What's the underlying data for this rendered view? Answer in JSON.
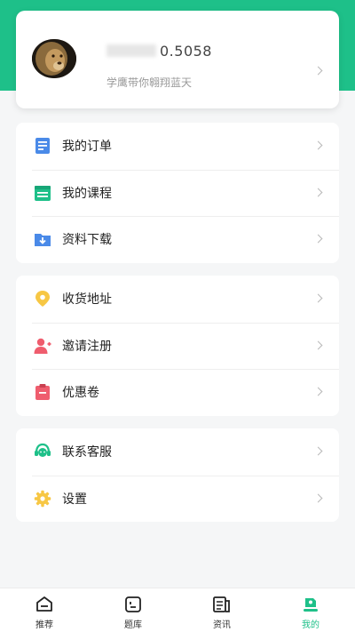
{
  "profile": {
    "username_visible": "0.5058",
    "slogan": "学鹰带你翱翔蓝天"
  },
  "groups": [
    {
      "items": [
        {
          "label": "我的订单",
          "icon": "order-list-icon",
          "color": "#4a8ae8"
        },
        {
          "label": "我的课程",
          "icon": "course-calendar-icon",
          "color": "#1ec089"
        },
        {
          "label": "资料下载",
          "icon": "folder-download-icon",
          "color": "#4a8ae8"
        }
      ]
    },
    {
      "items": [
        {
          "label": "收货地址",
          "icon": "location-pin-icon",
          "color": "#f7c744"
        },
        {
          "label": "邀请注册",
          "icon": "invite-user-icon",
          "color": "#ef5d6e"
        },
        {
          "label": "优惠卷",
          "icon": "coupon-clipboard-icon",
          "color": "#ef5d6e"
        }
      ]
    },
    {
      "items": [
        {
          "label": "联系客服",
          "icon": "customer-service-icon",
          "color": "#1ec089"
        },
        {
          "label": "设置",
          "icon": "settings-gear-icon",
          "color": "#f7c744"
        }
      ]
    }
  ],
  "tabbar": {
    "tabs": [
      {
        "label": "推荐",
        "icon": "home-icon",
        "active": false
      },
      {
        "label": "题库",
        "icon": "question-bank-icon",
        "active": false
      },
      {
        "label": "资讯",
        "icon": "news-icon",
        "active": false
      },
      {
        "label": "我的",
        "icon": "profile-icon",
        "active": true
      }
    ],
    "accent": "#1ec089"
  }
}
